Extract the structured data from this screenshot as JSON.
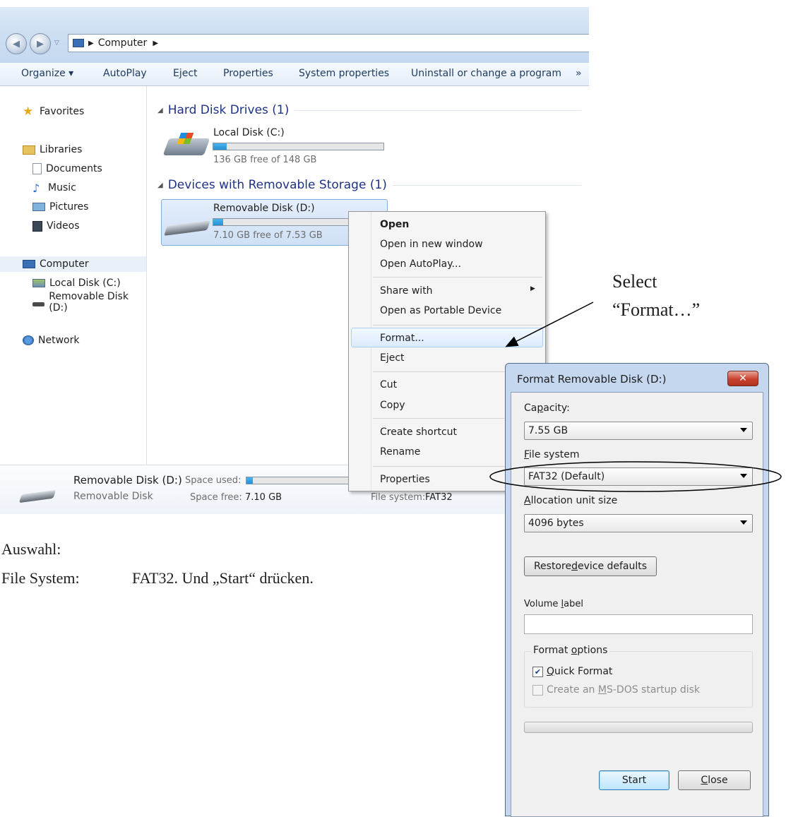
{
  "explorer": {
    "breadcrumb": "Computer",
    "toolbar": {
      "organize": "Organize ▾",
      "autoplay": "AutoPlay",
      "eject": "Eject",
      "properties": "Properties",
      "system_properties": "System properties",
      "uninstall": "Uninstall or change a program",
      "more": "»"
    },
    "sidebar": {
      "favorites": "Favorites",
      "libraries": "Libraries",
      "documents": "Documents",
      "music": "Music",
      "pictures": "Pictures",
      "videos": "Videos",
      "computer": "Computer",
      "local_disk": "Local Disk (C:)",
      "removable_disk": "Removable Disk (D:)",
      "network": "Network"
    },
    "groups": {
      "hdd_header": "Hard Disk Drives (1)",
      "removable_header": "Devices with Removable Storage (1)"
    },
    "drives": {
      "c_name": "Local Disk (C:)",
      "c_free": "136 GB free of 148 GB",
      "c_used_fraction": 0.08,
      "d_name": "Removable Disk (D:)",
      "d_free": "7.10 GB free of 7.53 GB",
      "d_used_fraction": 0.06
    },
    "status": {
      "name": "Removable Disk (D:)",
      "type": "Removable Disk",
      "space_used_label": "Space used:",
      "space_free_label": "Space free:",
      "space_free_value": "7.10 GB",
      "filesystem_label": "File system:",
      "filesystem_value": "FAT32"
    }
  },
  "context_menu": {
    "open": "Open",
    "open_new_window": "Open in new window",
    "open_autoplay": "Open AutoPlay...",
    "share_with": "Share with",
    "open_portable": "Open as Portable Device",
    "format": "Format...",
    "eject": "Eject",
    "cut": "Cut",
    "copy": "Copy",
    "create_shortcut": "Create shortcut",
    "rename": "Rename",
    "properties": "Properties"
  },
  "annotation": {
    "select_line1": "Select",
    "select_line2": "“Format…”",
    "auswahl": "Auswahl:",
    "filesystem_note_label": "File System:",
    "filesystem_note_text": "FAT32. Und „Start“ drücken."
  },
  "dialog": {
    "title": "Format Removable Disk (D:)",
    "capacity_label_pre": "Ca",
    "capacity_label_u": "p",
    "capacity_label_post": "acity:",
    "capacity_value": "7.55 GB",
    "fs_label_u": "F",
    "fs_label_post": "ile system",
    "fs_value": "FAT32 (Default)",
    "alloc_label_u": "A",
    "alloc_label_post": "llocation unit size",
    "alloc_value": "4096 bytes",
    "restore_pre": "Restore ",
    "restore_u": "d",
    "restore_post": "evice defaults",
    "volume_label_pre": "Volume ",
    "volume_label_u": "l",
    "volume_label_post": "abel",
    "volume_value": "",
    "options_label_pre": "Format ",
    "options_label_u": "o",
    "options_label_post": "ptions",
    "quick_u": "Q",
    "quick_post": "uick Format",
    "msdos_pre": "Create an ",
    "msdos_u": "M",
    "msdos_post": "S-DOS startup disk",
    "progress": 0,
    "start": "Start",
    "close_u": "C",
    "close_post": "lose"
  },
  "colors": {
    "accent": "#2690d6",
    "close_red": "#c8412f"
  }
}
